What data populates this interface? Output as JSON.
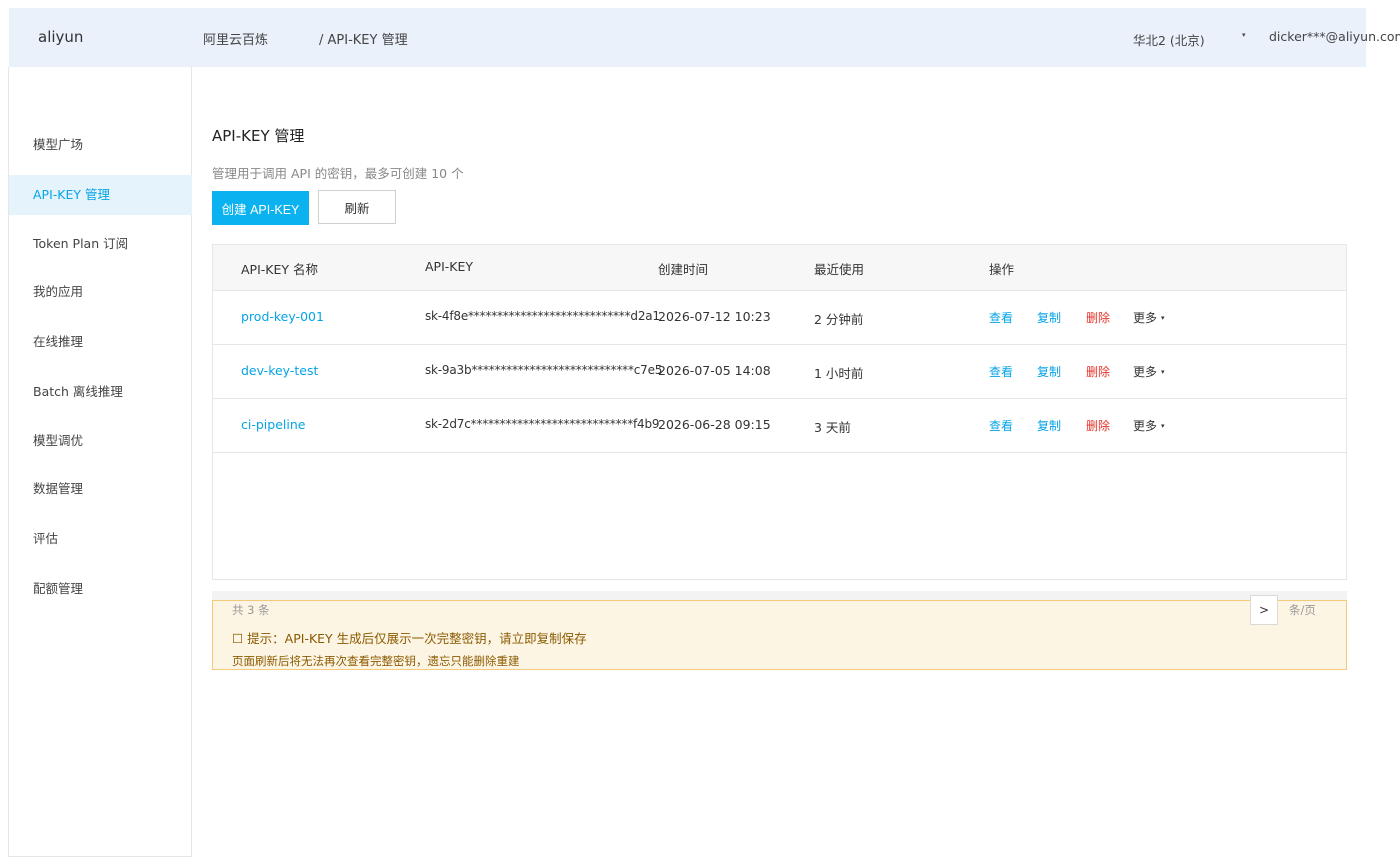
{
  "topbar": {
    "logo": "aliyun",
    "breadcrumb_root": "阿里云百炼",
    "breadcrumb_current": "/ API-KEY 管理",
    "region": "华北2 (北京)",
    "region_caret": "▾",
    "user": "dicker***@aliyun.com"
  },
  "sidebar": {
    "items": [
      {
        "label": "模型广场"
      },
      {
        "label": "API-KEY 管理"
      },
      {
        "label": "Token Plan 订阅"
      },
      {
        "label": "我的应用"
      },
      {
        "label": "在线推理"
      },
      {
        "label": "Batch 离线推理"
      },
      {
        "label": "模型调优"
      },
      {
        "label": "数据管理"
      },
      {
        "label": "评估"
      },
      {
        "label": "配额管理"
      }
    ]
  },
  "main": {
    "title": "API-KEY 管理",
    "description": "管理用于调用 API 的密钥，最多可创建 10 个",
    "create_button": "创建 API-KEY",
    "refresh_button": "刷新"
  },
  "table": {
    "headers": [
      "API-KEY 名称",
      "API-KEY",
      "创建时间",
      "最近使用",
      "操作"
    ],
    "rows": [
      {
        "name": "prod-key-001",
        "key": "sk-4f8e****************************d2a1",
        "created": "2026-07-12 10:23",
        "last_used": "2 分钟前"
      },
      {
        "name": "dev-key-test",
        "key": "sk-9a3b****************************c7e5",
        "created": "2026-07-05 14:08",
        "last_used": "1 小时前"
      },
      {
        "name": "ci-pipeline",
        "key": "sk-2d7c****************************f4b9",
        "created": "2026-06-28 09:15",
        "last_used": "3 天前"
      }
    ],
    "actions": {
      "view": "查看",
      "copy": "复制",
      "delete": "删除",
      "more": "更多",
      "more_caret": "▾"
    }
  },
  "footer": {
    "total": "共 3 条",
    "next": ">",
    "per_page": "条/页"
  },
  "notice": {
    "line1": "☐ 提示：API-KEY 生成后仅展示一次完整密钥，请立即复制保存",
    "line2": "页面刷新后将无法再次查看完整密钥，遗忘只能删除重建"
  },
  "colors": {
    "accent": "#0ab2f0",
    "link": "#06a4e6",
    "danger": "#e5342b",
    "header_bg": "#eaf1fb",
    "notice_bg": "#fdf5e4"
  }
}
